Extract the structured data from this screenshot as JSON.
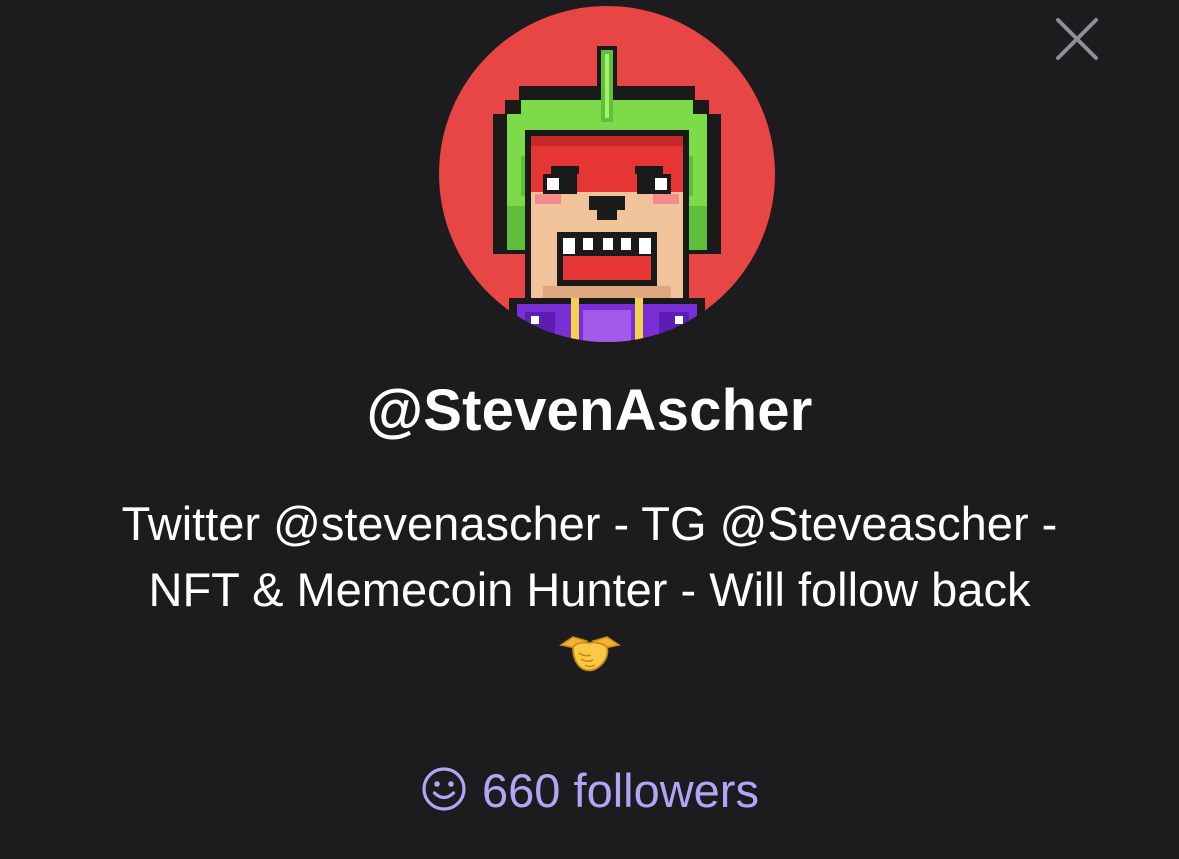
{
  "profile": {
    "username": "@StevenAscher",
    "bio_line_1": "Twitter @stevenascher - TG @Steveascher -",
    "bio_line_2": "NFT & Memecoin Hunter - Will follow back",
    "bio_emoji": "handshake-icon",
    "followers_label": "660 followers"
  },
  "icons": {
    "close": "close-icon",
    "followers": "smile-icon"
  },
  "colors": {
    "background": "#1c1c1e",
    "avatar_bg": "#e84545",
    "followers_accent": "#b3a4f5",
    "close_icon": "#8e8e93"
  }
}
